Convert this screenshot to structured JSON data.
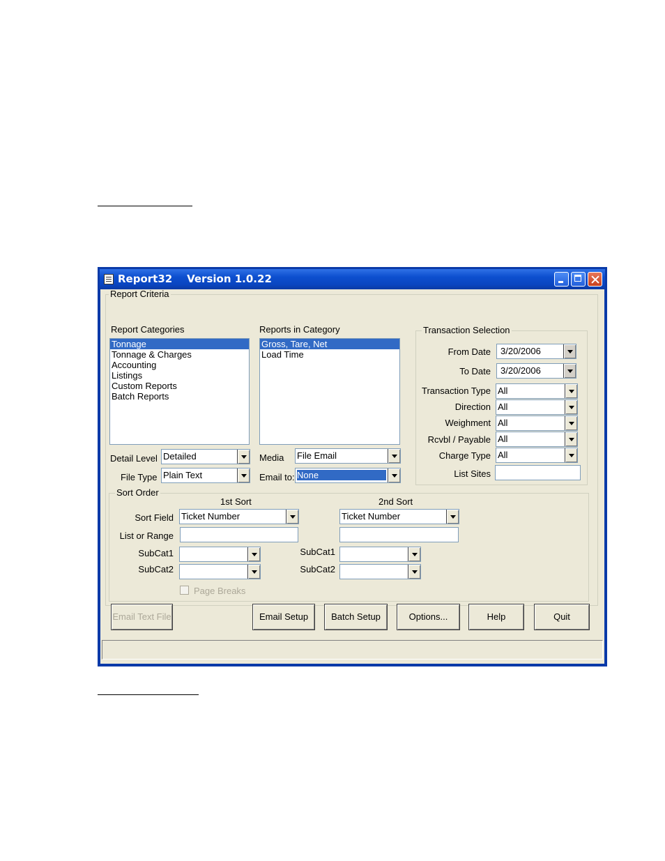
{
  "window": {
    "title": "Report32    Version 1.0.22"
  },
  "report_criteria": {
    "label": "Report Criteria",
    "categories": {
      "label": "Report Categories",
      "items": [
        "Tonnage",
        "Tonnage & Charges",
        "Accounting",
        "Listings",
        "Custom Reports",
        "Batch Reports"
      ],
      "selected": "Tonnage"
    },
    "reports": {
      "label": "Reports in Category",
      "items": [
        "Gross, Tare, Net",
        "Load Time"
      ],
      "selected": "Gross, Tare, Net"
    },
    "detail_level": {
      "label": "Detail Level",
      "value": "Detailed"
    },
    "file_type": {
      "label": "File Type",
      "value": "Plain Text"
    },
    "media": {
      "label": "Media",
      "value": "File Email"
    },
    "email_to": {
      "label": "Email to:",
      "value": "None"
    }
  },
  "transaction_selection": {
    "label": "Transaction Selection",
    "from_date": {
      "label": "From Date",
      "value": "3/20/2006"
    },
    "to_date": {
      "label": "To Date",
      "value": "3/20/2006"
    },
    "transaction_type": {
      "label": "Transaction Type",
      "value": "All"
    },
    "direction": {
      "label": "Direction",
      "value": "All"
    },
    "weighment": {
      "label": "Weighment",
      "value": "All"
    },
    "rcvbl_payable": {
      "label": "Rcvbl / Payable",
      "value": "All"
    },
    "charge_type": {
      "label": "Charge Type",
      "value": "All"
    },
    "list_sites": {
      "label": "List Sites",
      "value": ""
    }
  },
  "sort_order": {
    "label": "Sort Order",
    "first_sort": {
      "header": "1st Sort",
      "sort_field": "Ticket Number",
      "subcat1_label": "SubCat1",
      "subcat2_label": "SubCat2"
    },
    "second_sort": {
      "header": "2nd Sort",
      "sort_field": "Ticket Number",
      "subcat1_label": "SubCat1",
      "subcat2_label": "SubCat2"
    },
    "sort_field_label": "Sort Field",
    "list_or_range_label": "List or Range",
    "page_breaks_label": "Page Breaks"
  },
  "buttons": {
    "email_text_file": "Email Text File",
    "email_setup": "Email Setup",
    "batch_setup": "Batch Setup",
    "options": "Options...",
    "help": "Help",
    "quit": "Quit"
  }
}
